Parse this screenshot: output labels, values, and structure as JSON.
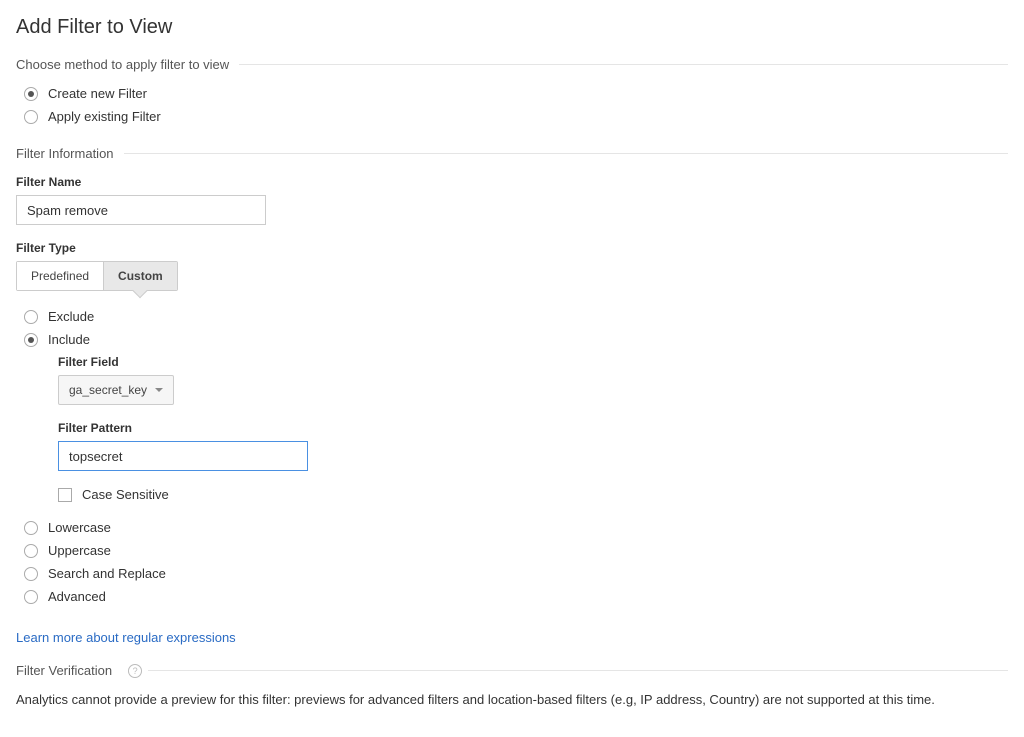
{
  "page": {
    "title": "Add Filter to View"
  },
  "method_section": {
    "header": "Choose method to apply filter to view",
    "options": {
      "create": "Create new Filter",
      "apply": "Apply existing Filter"
    },
    "selected": "create"
  },
  "filter_info": {
    "header": "Filter Information",
    "name_label": "Filter Name",
    "name_value": "Spam remove",
    "type_label": "Filter Type",
    "type_options": {
      "predefined": "Predefined",
      "custom": "Custom"
    },
    "type_selected": "custom"
  },
  "custom_filter": {
    "options": {
      "exclude": "Exclude",
      "include": "Include",
      "lowercase": "Lowercase",
      "uppercase": "Uppercase",
      "search_replace": "Search and Replace",
      "advanced": "Advanced"
    },
    "selected": "include",
    "include": {
      "field_label": "Filter Field",
      "field_value": "ga_secret_key",
      "pattern_label": "Filter Pattern",
      "pattern_value": "topsecret",
      "case_sensitive_label": "Case Sensitive",
      "case_sensitive_checked": false
    }
  },
  "regex_link": "Learn more about regular expressions",
  "verification": {
    "header": "Filter Verification",
    "message": "Analytics cannot provide a preview for this filter: previews for advanced filters and location-based filters (e.g, IP address, Country) are not supported at this time."
  }
}
